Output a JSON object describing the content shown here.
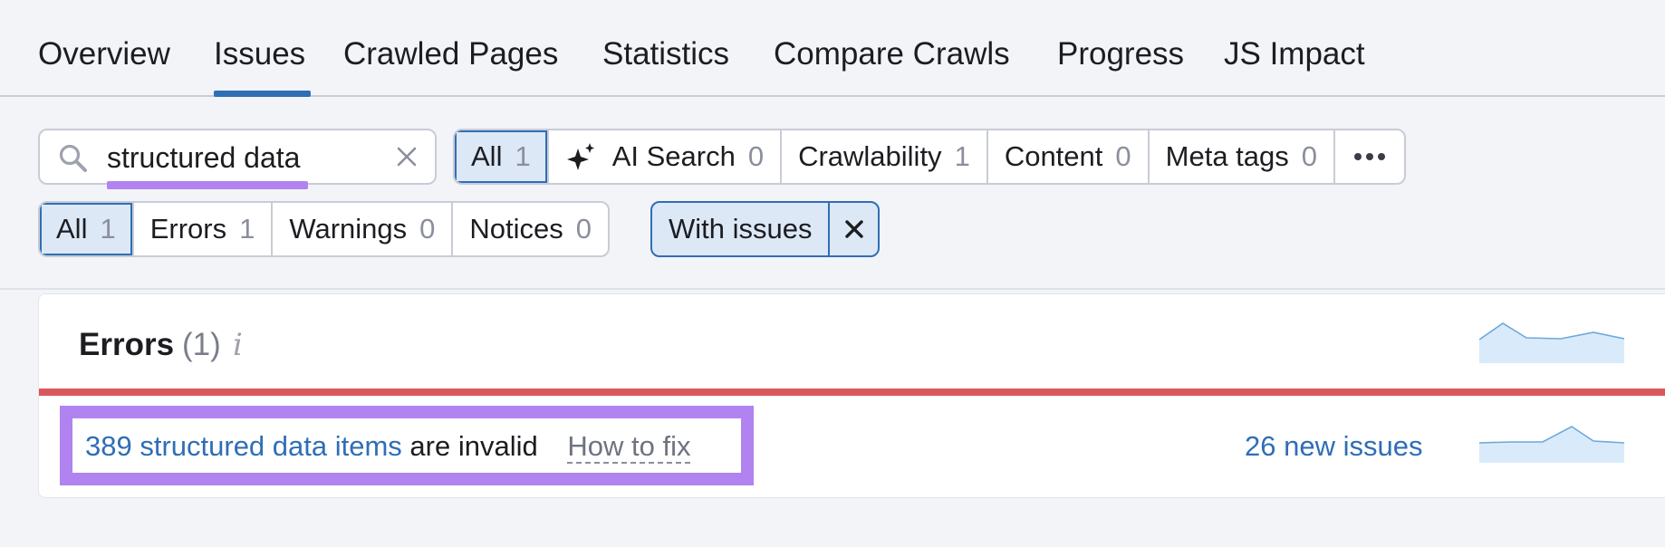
{
  "tabs": [
    {
      "label": "Overview"
    },
    {
      "label": "Issues"
    },
    {
      "label": "Crawled Pages"
    },
    {
      "label": "Statistics"
    },
    {
      "label": "Compare Crawls"
    },
    {
      "label": "Progress"
    },
    {
      "label": "JS Impact"
    }
  ],
  "active_tab": "Issues",
  "search": {
    "value": "structured data",
    "clear_icon": "close-icon",
    "search_icon": "search-icon"
  },
  "category_filter": [
    {
      "label": "All",
      "count": "1",
      "active": true
    },
    {
      "label": "AI Search",
      "count": "0",
      "icon": "sparkle-icon"
    },
    {
      "label": "Crawlability",
      "count": "1"
    },
    {
      "label": "Content",
      "count": "0"
    },
    {
      "label": "Meta tags",
      "count": "0"
    }
  ],
  "more_icon": "more-horizontal-icon",
  "severity_filter": [
    {
      "label": "All",
      "count": "1",
      "active": true
    },
    {
      "label": "Errors",
      "count": "1"
    },
    {
      "label": "Warnings",
      "count": "0"
    },
    {
      "label": "Notices",
      "count": "0"
    }
  ],
  "issues_chip": {
    "label": "With issues",
    "remove_icon": "close-icon"
  },
  "errors_card": {
    "title": "Errors",
    "count": "(1)",
    "info_icon": "info-icon",
    "issue": {
      "link_text": "389 structured data items",
      "rest_text": "are invalid",
      "fix_text": "How to fix",
      "new_issues": "26 new issues"
    }
  },
  "colors": {
    "accent": "#2f6eb5",
    "error_bar": "#d9585c",
    "highlight": "#b083f0",
    "background": "#f3f4f8"
  }
}
